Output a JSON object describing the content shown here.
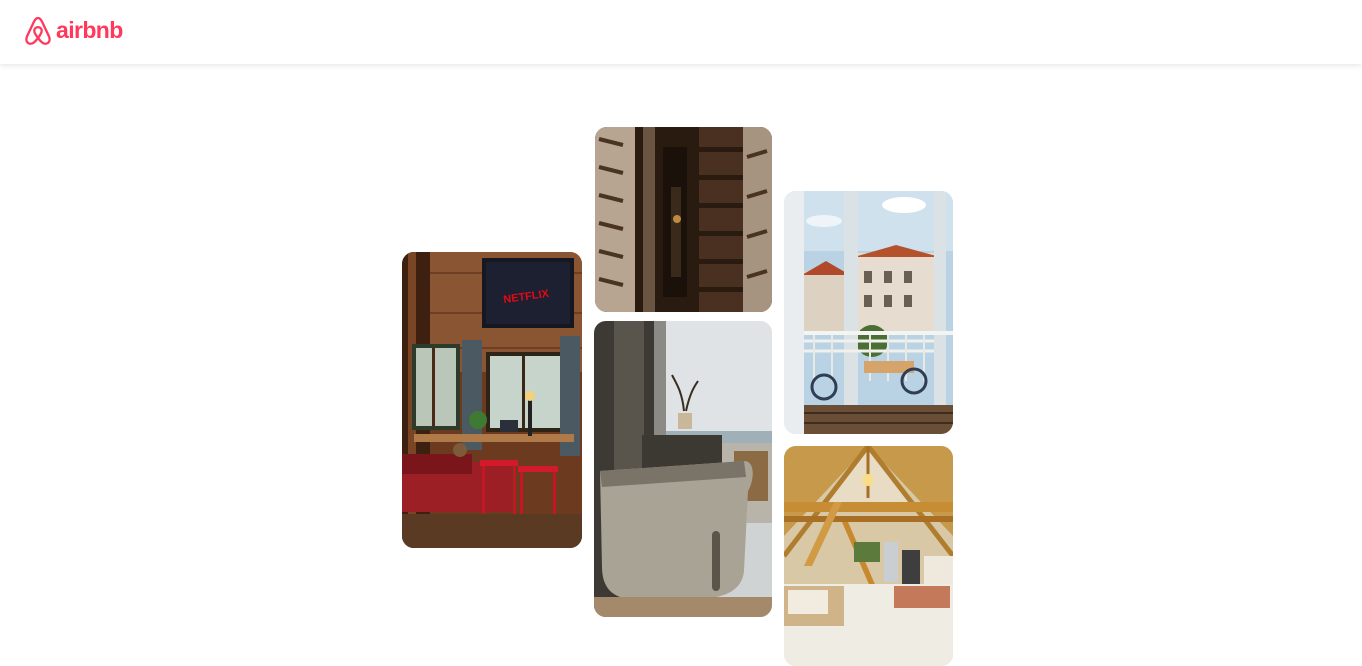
{
  "header": {
    "logo_text": "airbnb",
    "logo_icon": "airbnb-belo-icon",
    "brand_color": "#FF385C"
  },
  "gallery": {
    "photos": [
      {
        "subject": "cabin-room-tv",
        "screen_text": "NETFLIX"
      },
      {
        "subject": "spiral-staircase"
      },
      {
        "subject": "bathtub-window"
      },
      {
        "subject": "balcony-city-view"
      },
      {
        "subject": "a-frame-loft"
      }
    ]
  }
}
